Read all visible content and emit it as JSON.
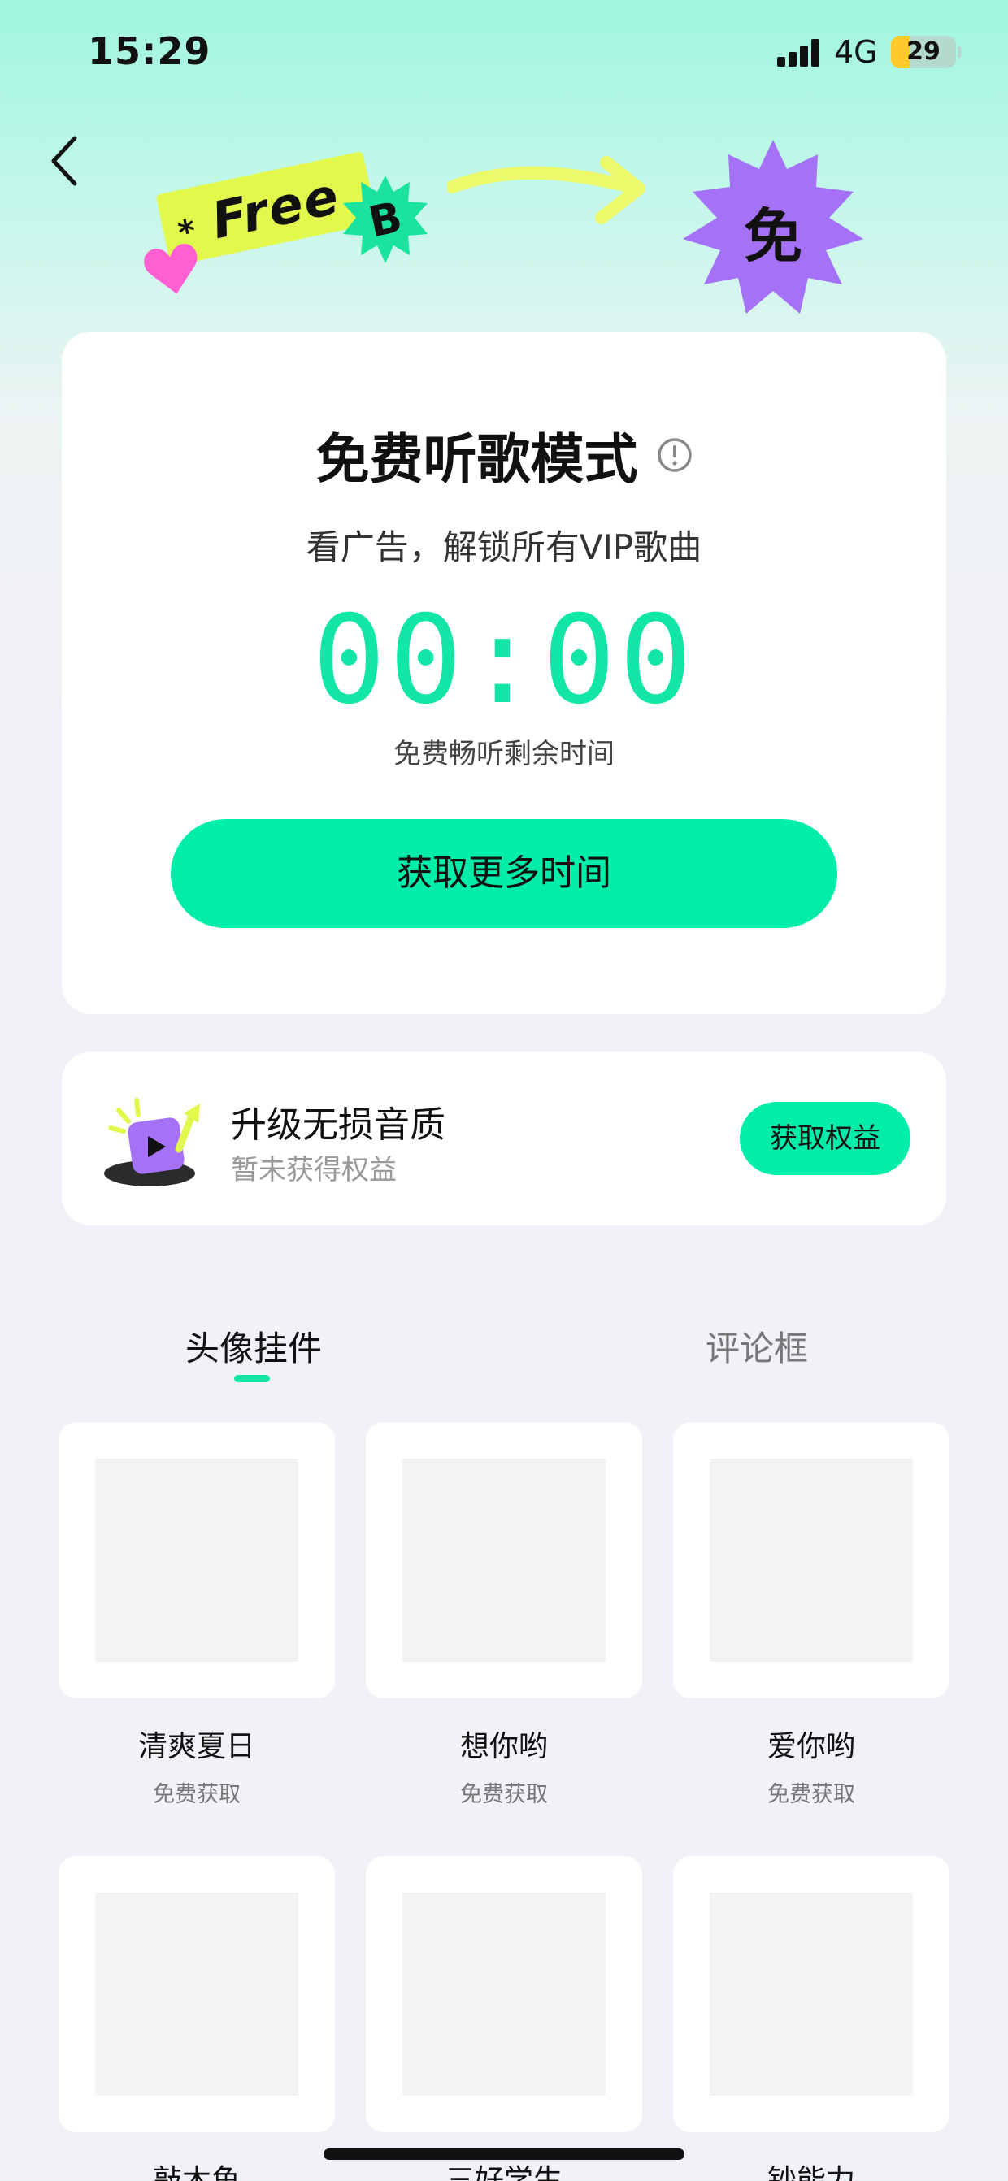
{
  "status_bar": {
    "time": "15:29",
    "network": "4G",
    "battery_level": "29",
    "battery_fraction": 0.29,
    "battery_color": "#ffc92c"
  },
  "header": {
    "back_icon": "chevron-left-icon",
    "free_tag_star": "*",
    "free_tag_text": "Free",
    "badge_letter": "B",
    "mian_glyph": "免"
  },
  "main_card": {
    "title": "免费听歌模式",
    "info_icon": "info-icon",
    "subtitle": "看广告，解锁所有VIP歌曲",
    "timer": "00:00",
    "timer_caption": "免费畅听剩余时间",
    "get_time_button": "获取更多时间",
    "accent_color": "#12e6a6"
  },
  "lossless_card": {
    "icon": "play-upgrade-icon",
    "title": "升级无损音质",
    "status": "暂未获得权益",
    "button": "获取权益"
  },
  "tabs": [
    {
      "label": "头像挂件",
      "active": true
    },
    {
      "label": "评论框",
      "active": false
    }
  ],
  "items": [
    {
      "name": "清爽夏日",
      "sub": "免费获取"
    },
    {
      "name": "想你哟",
      "sub": "免费获取"
    },
    {
      "name": "爱你哟",
      "sub": "免费获取"
    },
    {
      "name": "敲木鱼",
      "sub": ""
    },
    {
      "name": "三好学生",
      "sub": ""
    },
    {
      "name": "钞能力",
      "sub": ""
    }
  ]
}
